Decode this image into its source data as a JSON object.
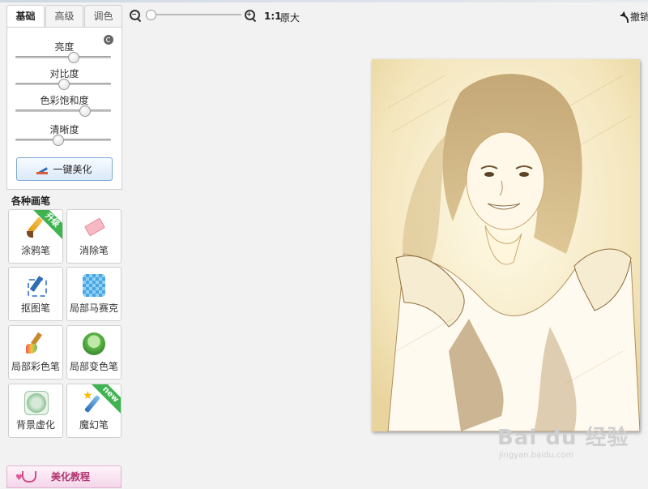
{
  "left_panel": {
    "tabs": [
      "基础",
      "高级",
      "调色"
    ],
    "adjustments": [
      {
        "label": "亮度",
        "value": 0.6
      },
      {
        "label": "对比度",
        "value": 0.5
      },
      {
        "label": "色彩饱和度",
        "value": 0.72
      },
      {
        "label": "清晰度",
        "value": 0.44
      }
    ],
    "one_click_label": "一键美化",
    "brushes_title": "各种画笔",
    "tools": [
      {
        "label": "涂鸦笔",
        "icon": "paintbrush-icon",
        "badge": "升级"
      },
      {
        "label": "消除笔",
        "icon": "eraser-icon",
        "badge": ""
      },
      {
        "label": "抠图笔",
        "icon": "cutout-pen-icon",
        "badge": ""
      },
      {
        "label": "局部马赛克",
        "icon": "mosaic-icon",
        "badge": ""
      },
      {
        "label": "局部彩色笔",
        "icon": "color-brush-icon",
        "badge": ""
      },
      {
        "label": "局部变色笔",
        "icon": "color-change-icon",
        "badge": ""
      },
      {
        "label": "背景虚化",
        "icon": "background-blur-icon",
        "badge": ""
      },
      {
        "label": "魔幻笔",
        "icon": "magic-wand-icon",
        "badge": "new"
      }
    ],
    "tutorial_label": "美化教程"
  },
  "toolbar": {
    "zoom_value": 0.0,
    "one_to_one": "1:1",
    "original_size": "原大",
    "undo_label": "撤销"
  },
  "watermark": {
    "logo": "Bai du 经验",
    "sub": "jingyan.baidu.com"
  }
}
